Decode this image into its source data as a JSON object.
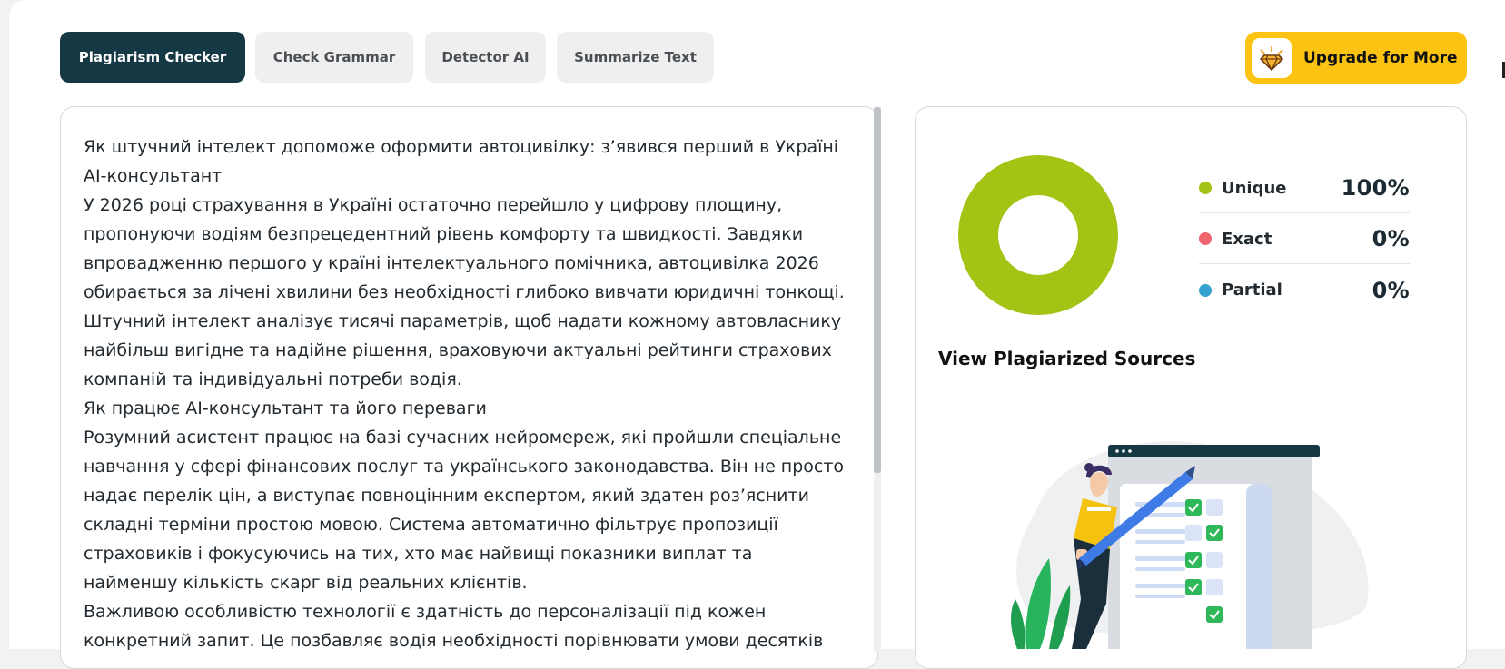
{
  "tabs": [
    {
      "label": "Plagiarism Checker",
      "active": true
    },
    {
      "label": "Check Grammar",
      "active": false
    },
    {
      "label": "Detector AI",
      "active": false
    },
    {
      "label": "Summarize Text",
      "active": false
    }
  ],
  "upgrade": {
    "label": "Upgrade for More",
    "icon": "diamond-icon"
  },
  "editor": {
    "paragraphs": [
      "Як штучний інтелект допоможе оформити автоцивілку: з’явився перший в Україні AI-консультант",
      "У 2026 році страхування в Україні остаточно перейшло у цифрову площину, пропонуючи водіям безпрецедентний рівень комфорту та швидкості. Завдяки впровадженню першого у країні інтелектуального помічника, автоцивілка 2026 обирається за лічені хвилини без необхідності глибоко вивчати юридичні тонкощі. Штучний інтелект аналізує тисячі параметрів, щоб надати кожному автовласнику найбільш вигідне та надійне рішення, враховуючи актуальні рейтинги страхових компаній та індивідуальні потреби водія.",
      "Як працює AI-консультант та його переваги",
      "Розумний асистент працює на базі сучасних нейромереж, які пройшли спеціальне навчання у сфері фінансових послуг та українського законодавства. Він не просто надає перелік цін, а виступає повноцінним експертом, який здатен роз’яснити складні терміни простою мовою. Система автоматично фільтрує пропозиції страховиків і фокусуючись на тих, хто має найвищі показники виплат та найменшу кількість скарг від реальних клієнтів.",
      "Важливою особливістю технології є здатність до персоналізації під кожен конкретний запит. Це позбавляє водія необхідності порівнювати умови десятків"
    ]
  },
  "results": {
    "legend": [
      {
        "label": "Unique",
        "value": "100%",
        "color": "#a3c414"
      },
      {
        "label": "Exact",
        "value": "0%",
        "color": "#f0646e"
      },
      {
        "label": "Partial",
        "value": "0%",
        "color": "#35a3cf"
      }
    ],
    "donut": {
      "unique": 100,
      "exact": 0,
      "partial": 0,
      "color": "#a3c414"
    },
    "sources_title": "View Plagiarized Sources"
  }
}
